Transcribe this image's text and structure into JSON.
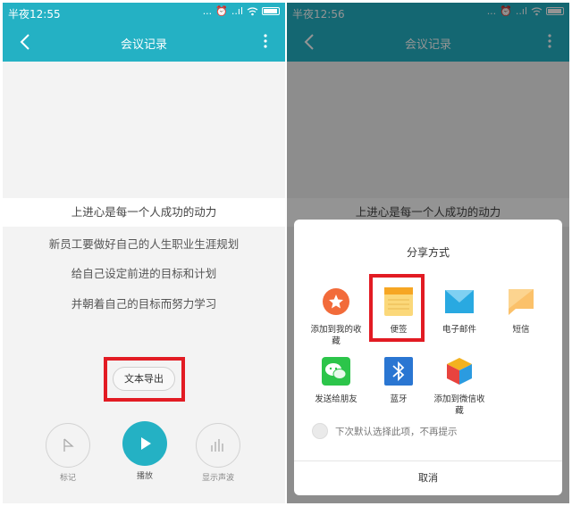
{
  "left": {
    "status": {
      "time": "半夜12:55",
      "dots": "...",
      "signal": "..ıl"
    },
    "appbar": {
      "title": "会议记录"
    },
    "lyrics": [
      "上进心是每一个人成功的动力",
      "新员工要做好自己的人生职业生涯规划",
      "给自己设定前进的目标和计划",
      "并朝着自己的目标而努力学习"
    ],
    "export_label": "文本导出",
    "controls": {
      "mark": "标记",
      "play": "播放",
      "waveform": "显示声波"
    }
  },
  "right": {
    "status": {
      "time": "半夜12:56",
      "dots": "...",
      "signal": "..ıl"
    },
    "appbar": {
      "title": "会议记录"
    },
    "active_lyric": "上进心是每一个人成功的动力",
    "sheet": {
      "title": "分享方式",
      "items": [
        {
          "label": "添加到我的收藏",
          "icon": "favorite-star-icon"
        },
        {
          "label": "便签",
          "icon": "notes-icon"
        },
        {
          "label": "电子邮件",
          "icon": "email-icon"
        },
        {
          "label": "短信",
          "icon": "sms-icon"
        },
        {
          "label": "发送给朋友",
          "icon": "wechat-icon"
        },
        {
          "label": "蓝牙",
          "icon": "bluetooth-icon"
        },
        {
          "label": "添加到微信收藏",
          "icon": "wechat-favorite-cube-icon"
        }
      ],
      "default_text": "下次默认选择此项，不再提示",
      "cancel": "取消"
    }
  },
  "colors": {
    "accent": "#24b1c4",
    "highlight": "#e21b23"
  }
}
